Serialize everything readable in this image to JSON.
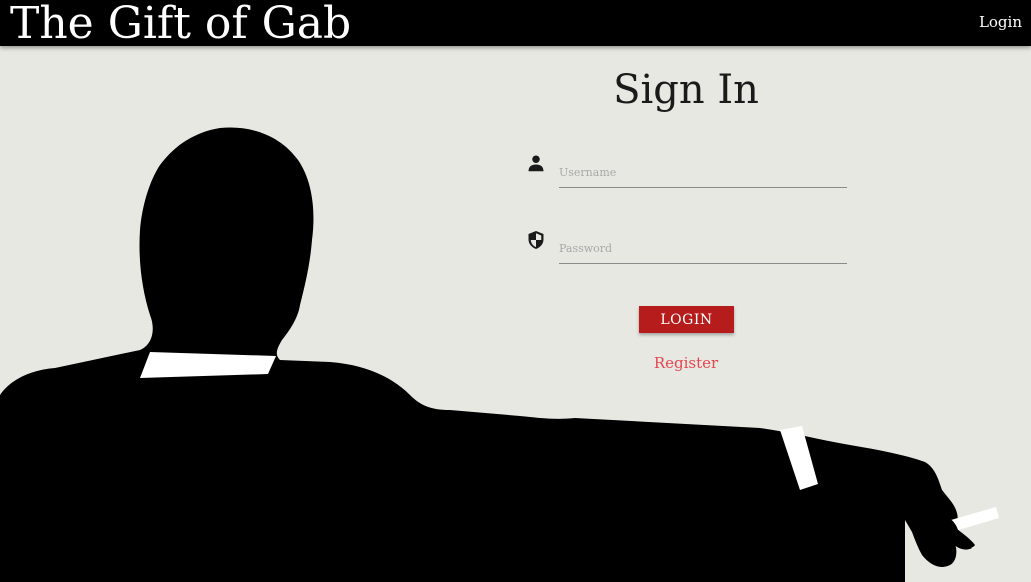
{
  "header": {
    "brand": "The Gift of Gab",
    "login_link": "Login"
  },
  "form": {
    "title": "Sign In",
    "username": {
      "placeholder": "Username",
      "value": "",
      "icon": "person-icon"
    },
    "password": {
      "placeholder": "Password",
      "value": "",
      "icon": "shield-icon"
    },
    "login_button": "LOGIN",
    "register_link": "Register"
  },
  "colors": {
    "topbar": "#000000",
    "background": "#e8e8e3",
    "button": "#b71c1c",
    "register_link": "#e5454f"
  }
}
